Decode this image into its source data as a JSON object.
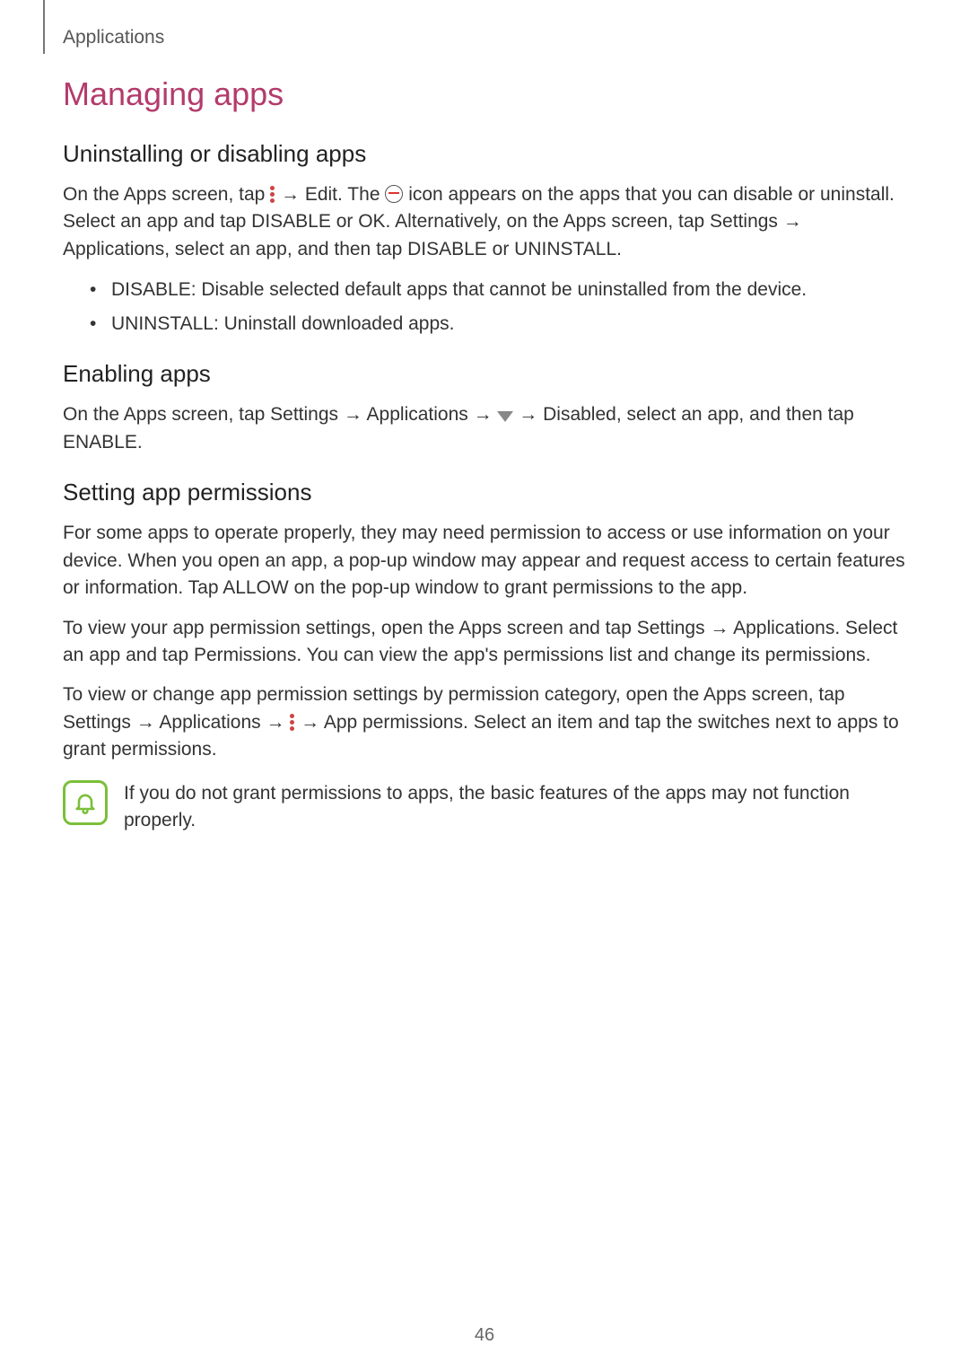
{
  "header": {
    "section": "Applications"
  },
  "title": "Managing apps",
  "s1": {
    "heading": "Uninstalling or disabling apps",
    "p1a": "On the Apps screen, tap ",
    "p1b": " → Edit. The ",
    "p1c": " icon appears on the apps that you can disable or uninstall. Select an app and tap DISABLE or OK. Alternatively, on the Apps screen, tap Settings → Applications, select an app, and then tap DISABLE or UNINSTALL.",
    "bullets": [
      "DISABLE: Disable selected default apps that cannot be uninstalled from the device.",
      "UNINSTALL: Uninstall downloaded apps."
    ]
  },
  "s2": {
    "heading": "Enabling apps",
    "p1a": "On the Apps screen, tap Settings → Applications → ",
    "p1b": " → Disabled, select an app, and then tap ENABLE."
  },
  "s3": {
    "heading": "Setting app permissions",
    "p1": "For some apps to operate properly, they may need permission to access or use information on your device. When you open an app, a pop-up window may appear and request access to certain features or information. Tap ALLOW on the pop-up window to grant permissions to the app.",
    "p2": "To view your app permission settings, open the Apps screen and tap Settings → Applications. Select an app and tap Permissions. You can view the app's permissions list and change its permissions.",
    "p3a": "To view or change app permission settings by permission category, open the Apps screen, tap Settings → Applications → ",
    "p3b": " → App permissions. Select an item and tap the switches next to apps to grant permissions.",
    "note": "If you do not grant permissions to apps, the basic features of the apps may not function properly."
  },
  "pageNumber": "46"
}
